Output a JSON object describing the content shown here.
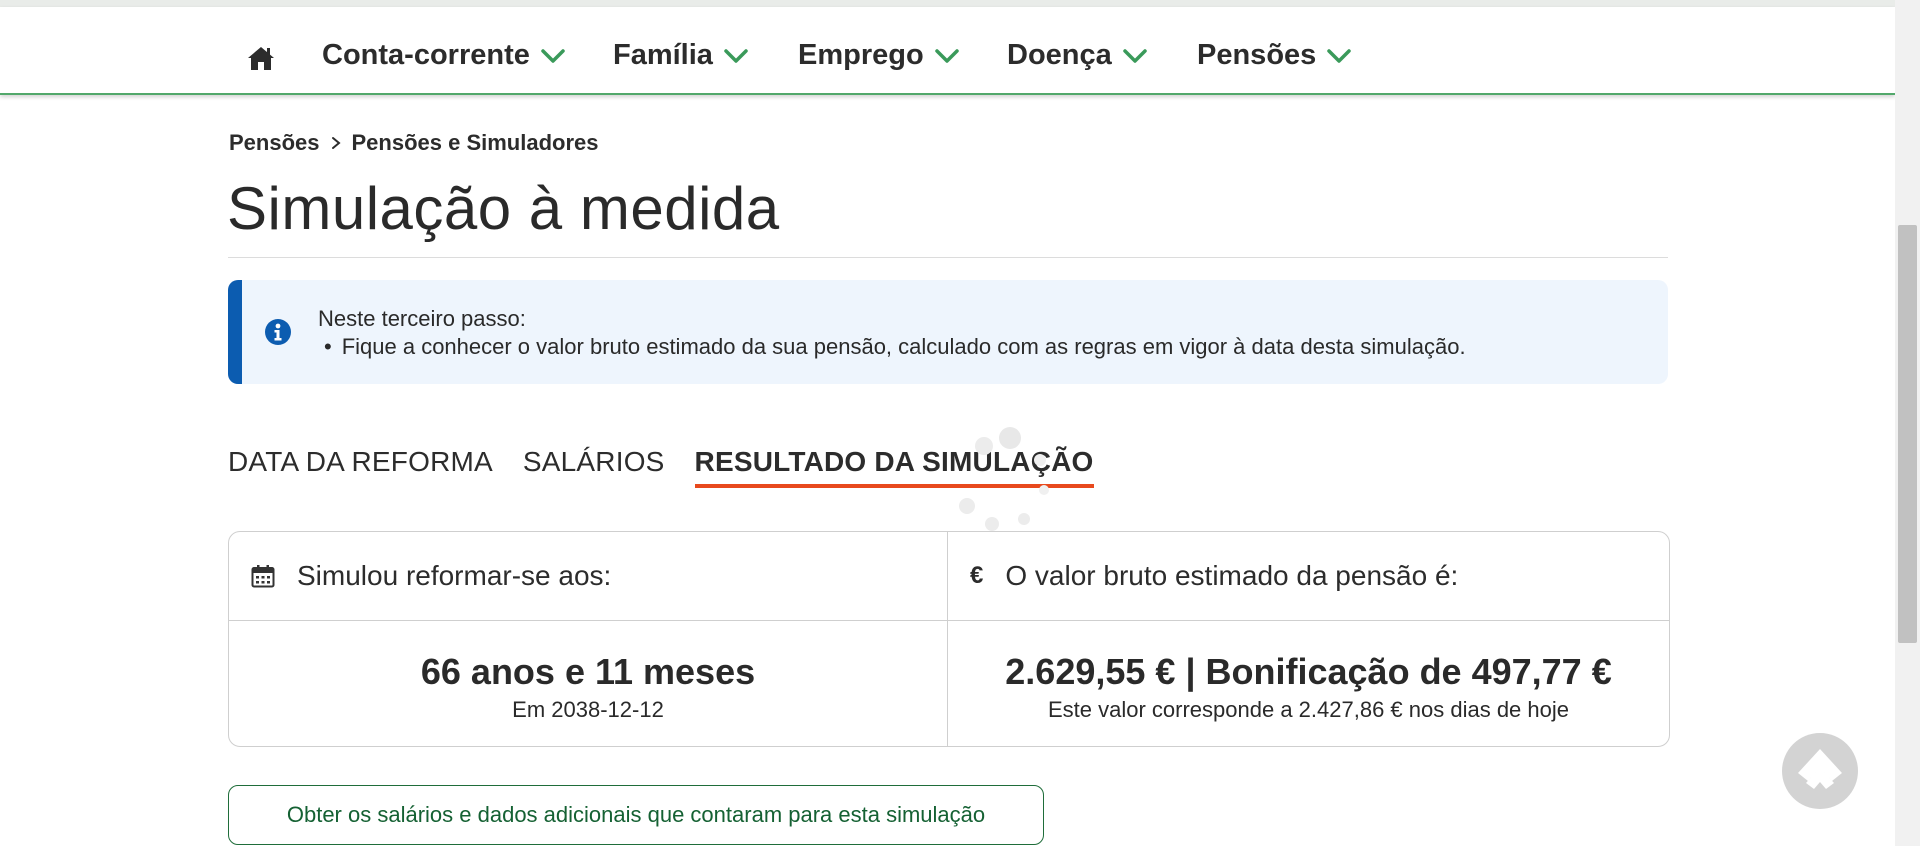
{
  "nav": {
    "items": [
      {
        "label": "Conta-corrente"
      },
      {
        "label": "Família"
      },
      {
        "label": "Emprego"
      },
      {
        "label": "Doença"
      },
      {
        "label": "Pensões"
      }
    ]
  },
  "breadcrumb": [
    "Pensões",
    "Pensões e Simuladores"
  ],
  "page_title": "Simulação à medida",
  "info": {
    "heading": "Neste terceiro passo:",
    "bullet": "Fique a conhecer o valor bruto estimado da sua pensão, calculado com as regras em vigor à data desta simulação."
  },
  "tabs": [
    {
      "label": "DATA DA REFORMA",
      "active": false
    },
    {
      "label": "SALÁRIOS",
      "active": false
    },
    {
      "label": "RESULTADO DA SIMULAÇÃO",
      "active": true
    }
  ],
  "results": {
    "left": {
      "header": "Simulou reformar-se aos:",
      "value": "66 anos e 11 meses",
      "sub": "Em 2038-12-12"
    },
    "right": {
      "currency_symbol": "€",
      "header": "O valor bruto estimado da pensão é:",
      "value": "2.629,55 € | Bonificação de 497,77 €",
      "sub": "Este valor corresponde a 2.427,86 € nos dias de hoje"
    }
  },
  "cta_label": "Obter os salários e dados adicionais que contaram para esta simulação",
  "colors": {
    "nav_accent": "#52a86b",
    "info_bar": "#0c5cb0",
    "active_tab_underline": "#e8491d",
    "cta_text": "#156133"
  },
  "icons": [
    "home-icon",
    "chevron-down-icon",
    "chevron-right-icon",
    "info-icon",
    "calendar-icon",
    "loading-spinner-icon",
    "back-to-top-icon"
  ]
}
